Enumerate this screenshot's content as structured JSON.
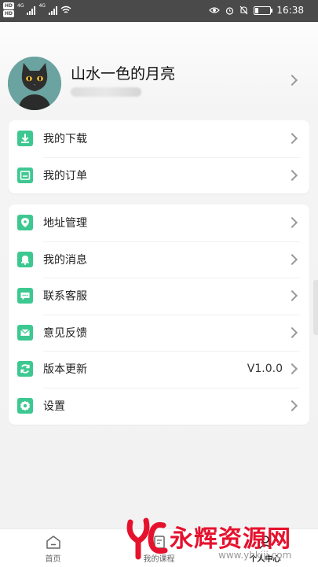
{
  "status_bar": {
    "time": "16:38",
    "hd1": "HD",
    "hd2": "HD",
    "net1": "4G",
    "net2": "4G",
    "battery_level": 0.2
  },
  "profile": {
    "username": "山水一色的月亮"
  },
  "menu_group1": [
    {
      "label": "我的下载",
      "icon": "download-icon"
    },
    {
      "label": "我的订单",
      "icon": "order-icon"
    }
  ],
  "menu_group2": [
    {
      "label": "地址管理",
      "icon": "location-icon"
    },
    {
      "label": "我的消息",
      "icon": "bell-icon"
    },
    {
      "label": "联系客服",
      "icon": "chat-icon"
    },
    {
      "label": "意见反馈",
      "icon": "mail-icon"
    },
    {
      "label": "版本更新",
      "icon": "refresh-icon",
      "value": "V1.0.0"
    },
    {
      "label": "设置",
      "icon": "gear-icon"
    }
  ],
  "bottom_nav": [
    {
      "label": "首页",
      "icon": "home-icon"
    },
    {
      "label": "我的课程",
      "icon": "course-icon"
    },
    {
      "label": "个人中心",
      "icon": "user-icon",
      "active": true
    }
  ],
  "watermark": {
    "text": "永辉资源网",
    "url": "www.yhkjjj.com"
  },
  "colors": {
    "accent": "#3ec891",
    "status_bar": "#4a4a4a",
    "watermark": "#e5122e"
  }
}
